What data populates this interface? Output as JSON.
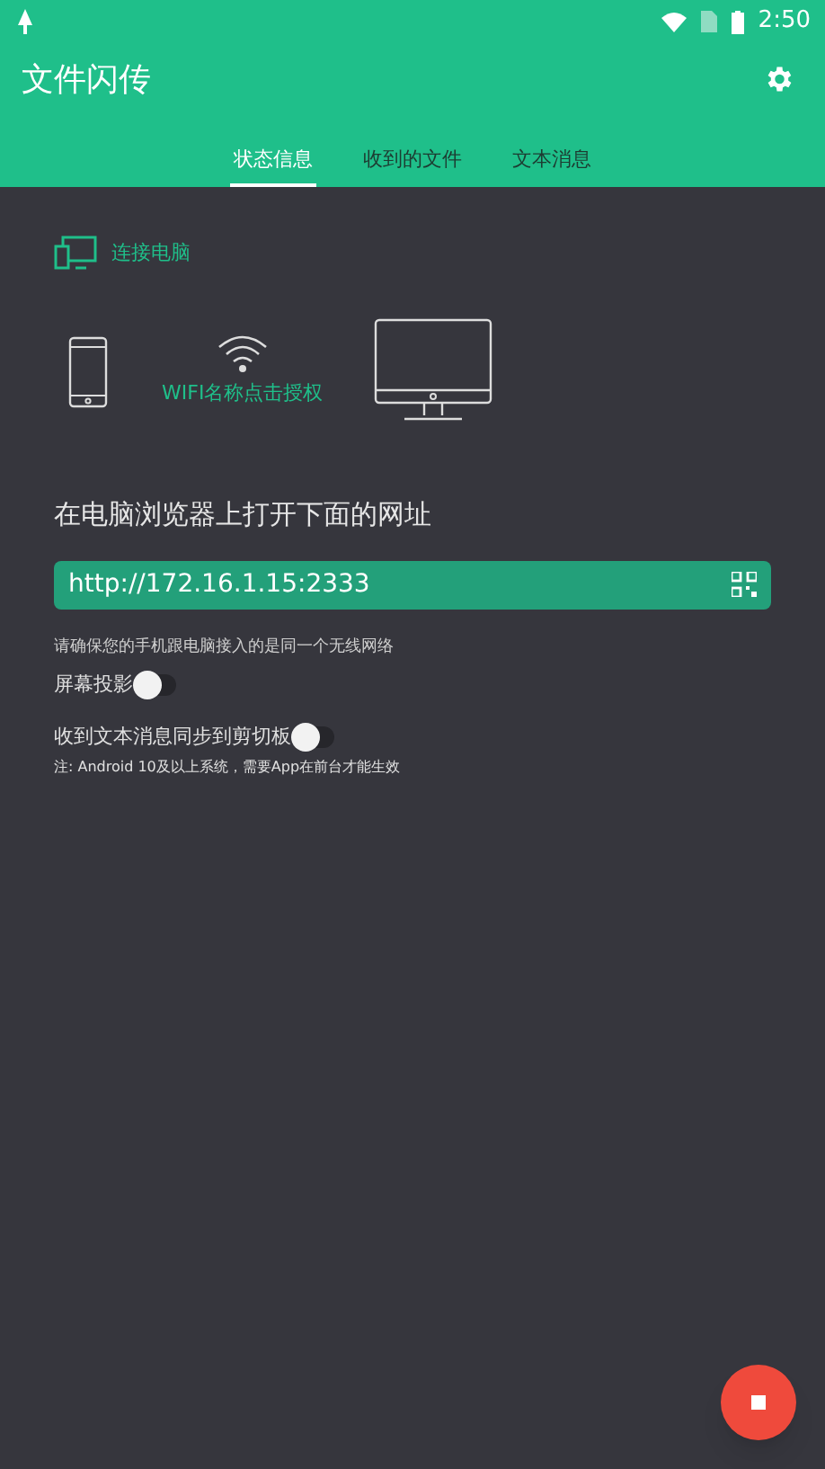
{
  "status_bar": {
    "time": "2:50"
  },
  "app_bar": {
    "title": "文件闪传"
  },
  "tabs": [
    {
      "label": "状态信息",
      "selected": true
    },
    {
      "label": "收到的文件",
      "selected": false
    },
    {
      "label": "文本消息",
      "selected": false
    }
  ],
  "connect": {
    "label": "连接电脑",
    "wifi_label": "WIFI名称点击授权"
  },
  "instruction": "在电脑浏览器上打开下面的网址",
  "url": "http://172.16.1.15:2333",
  "network_note": "请确保您的手机跟电脑接入的是同一个无线网络",
  "toggles": [
    {
      "label": "屏幕投影",
      "on": false
    },
    {
      "label": "收到文本消息同步到剪切板",
      "on": false
    }
  ],
  "footnote": "注: Android 10及以上系统，需要App在前台才能生效"
}
